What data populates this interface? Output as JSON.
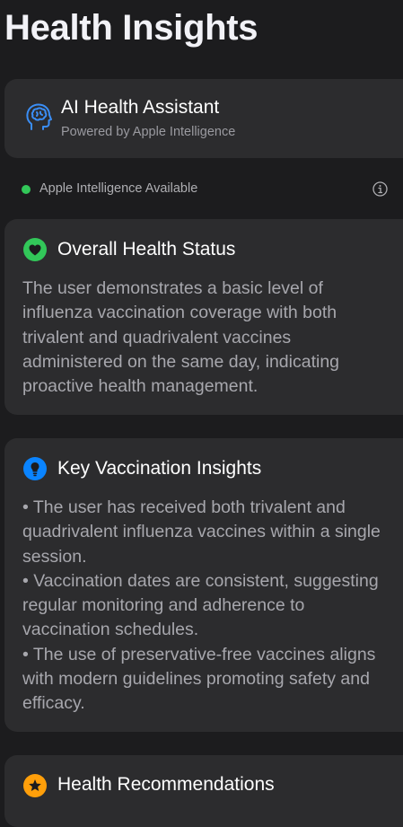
{
  "page_title": "Health Insights",
  "assistant": {
    "title": "AI Health Assistant",
    "subtitle": "Powered by Apple Intelligence",
    "icon": "brain-head-icon"
  },
  "status": {
    "text": "Apple Intelligence Available",
    "color": "#32c759"
  },
  "overall": {
    "title": "Overall Health Status",
    "icon": "heart-icon",
    "color": "#32c759",
    "body": "The user demonstrates a basic level of influenza vaccination coverage with both trivalent and quadrivalent vaccines administered on the same day, indicating proactive health management."
  },
  "insights": {
    "title": "Key Vaccination Insights",
    "icon": "lightbulb-icon",
    "color": "#0a84ff",
    "bullets": [
      "• The user has received both trivalent and quadrivalent influenza vaccines within a single session.",
      "• Vaccination dates are consistent, suggesting regular monitoring and adherence to vaccination schedules.",
      "• The use of preservative-free vaccines aligns with modern guidelines promoting safety and efficacy."
    ]
  },
  "recommendations": {
    "title": "Health Recommendations",
    "icon": "star-icon",
    "color": "#ff9f0a"
  }
}
